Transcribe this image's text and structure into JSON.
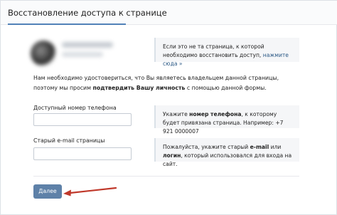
{
  "header": {
    "title": "Восстановление доступа к странице"
  },
  "notice": {
    "text": "Если это не та страница, к которой необходимо восстановить доступ, ",
    "link": "нажмите сюда »"
  },
  "intro": {
    "part1": "Нам необходимо удостовериться, что Вы являетесь владельцем данной страницы, поэтому мы просим ",
    "bold": "подтвердить Вашу личность",
    "part2": " с помощью данной формы."
  },
  "phone": {
    "label": "Доступный номер телефона",
    "value": "",
    "hint_part1": "Укажите ",
    "hint_bold": "номер телефона",
    "hint_part2": ", к которому будет привязана страница. Например: +7 921 0000007"
  },
  "email": {
    "label": "Старый e-mail страницы",
    "value": "",
    "hint_part1": "Пожалуйста, укажите старый ",
    "hint_bold1": "e-mail",
    "hint_mid": " или ",
    "hint_bold2": "логин",
    "hint_part2": ", который использовался для входа на сайт."
  },
  "actions": {
    "next_label": "Далее"
  },
  "colors": {
    "accent": "#5181b8",
    "button": "#5e81a8",
    "arrow": "#c0392b",
    "link": "#2a5885"
  }
}
